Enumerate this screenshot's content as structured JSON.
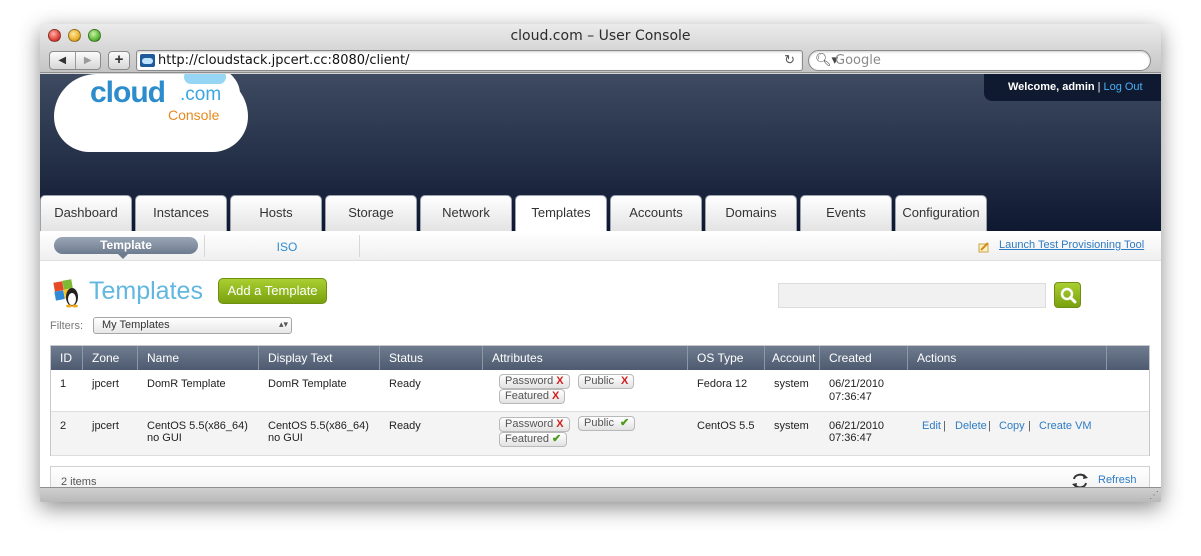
{
  "browser": {
    "window_title": "cloud.com – User Console",
    "url": "http://cloudstack.jpcert.cc:8080/client/",
    "search_placeholder": "Google",
    "back_glyph": "◀",
    "forward_glyph": "▶",
    "add_glyph": "+",
    "reload_glyph": "↻",
    "search_glyph": "🔍︎▾"
  },
  "header": {
    "logo_cloud": "cloud",
    "logo_com": ".com",
    "logo_console": "Console",
    "welcome": "Welcome, admin",
    "separator": "|",
    "logout": "Log Out"
  },
  "tabs": [
    {
      "label": "Dashboard"
    },
    {
      "label": "Instances"
    },
    {
      "label": "Hosts"
    },
    {
      "label": "Storage"
    },
    {
      "label": "Network"
    },
    {
      "label": "Templates"
    },
    {
      "label": "Accounts"
    },
    {
      "label": "Domains"
    },
    {
      "label": "Events"
    },
    {
      "label": "Configuration"
    }
  ],
  "active_tab": "Templates",
  "subnav": {
    "active": "Template",
    "other": "ISO",
    "launch": "Launch Test Provisioning Tool"
  },
  "page": {
    "title": "Templates",
    "add_button": "Add a Template",
    "filters_label": "Filters:",
    "filter_value": "My Templates",
    "search_value": ""
  },
  "table": {
    "columns": [
      "ID",
      "Zone",
      "Name",
      "Display Text",
      "Status",
      "Attributes",
      "OS Type",
      "Account",
      "Created",
      "Actions"
    ],
    "rows": [
      {
        "id": "1",
        "zone": "jpcert",
        "name": "DomR Template",
        "display_text": "DomR Template",
        "status": "Ready",
        "password_label": "Password",
        "password": false,
        "public_label": "Public",
        "public": false,
        "featured_label": "Featured",
        "featured": false,
        "os_type": "Fedora 12",
        "account": "system",
        "created_date": "06/21/2010",
        "created_time": "07:36:47"
      },
      {
        "id": "2",
        "zone": "jpcert",
        "name_line1": "CentOS 5.5(x86_64)",
        "name_line2": "no GUI",
        "display_line1": "CentOS 5.5(x86_64)",
        "display_line2": "no GUI",
        "status": "Ready",
        "password_label": "Password",
        "password": false,
        "public_label": "Public",
        "public": true,
        "featured_label": "Featured",
        "featured": true,
        "os_type": "CentOS 5.5",
        "account": "system",
        "created_date": "06/21/2010",
        "created_time": "07:36:47",
        "actions": [
          "Edit",
          "Delete",
          "Copy",
          "Create VM"
        ]
      }
    ],
    "yes_mark": "✔",
    "no_mark": "X",
    "action_sep": "|"
  },
  "footer": {
    "count": "2 items",
    "refresh": "Refresh"
  },
  "colors": {
    "accent_green": "#8bb51e",
    "title_blue": "#61b7e0",
    "link_blue": "#2e7cc4",
    "header_navy": "#243048"
  }
}
